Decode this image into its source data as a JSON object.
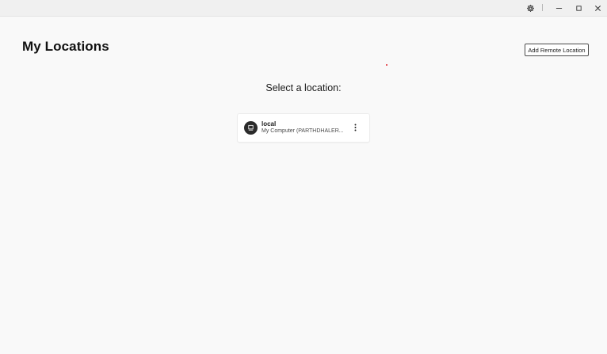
{
  "window": {
    "controls": {
      "settings_icon": "gear-icon",
      "minimize_icon": "minimize-icon",
      "maximize_icon": "maximize-icon",
      "close_icon": "close-icon"
    }
  },
  "header": {
    "title": "My Locations",
    "add_remote_label": "Add Remote Location"
  },
  "main": {
    "heading": "Select a location:",
    "locations": [
      {
        "name": "local",
        "description": "My Computer (PARTHDHALER...",
        "icon": "computer-icon",
        "menu_icon": "more-vertical-icon"
      }
    ]
  },
  "colors": {
    "background": "#f9f9f9",
    "titlebar": "#f0f0f0",
    "avatar": "#2b2b2b",
    "accent_dot": "#e0242e"
  }
}
